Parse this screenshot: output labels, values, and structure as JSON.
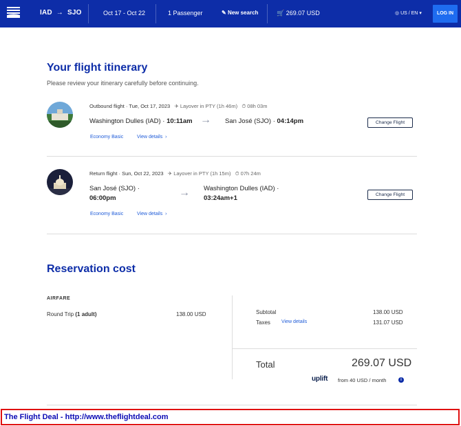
{
  "header": {
    "route_from": "IAD",
    "route_to": "SJO",
    "dates": "Oct 17 - Oct 22",
    "passengers": "1 Passenger",
    "new_search": "New search",
    "cart_price": "269.07 USD",
    "locale": "US / EN",
    "login": "LOG IN"
  },
  "itinerary": {
    "title": "Your flight itinerary",
    "subtitle": "Please review your itinerary carefully before continuing.",
    "flights": [
      {
        "label": "Outbound flight · Tue, Oct 17, 2023",
        "layover": "Layover in PTY (1h 46m)",
        "duration": "08h 03m",
        "origin": "Washington Dulles (IAD) ·",
        "origin_time": "10:11am",
        "destination": "San José (SJO) ·",
        "destination_time": "04:14pm",
        "fare": "Economy Basic",
        "details": "View details",
        "change": "Change Flight"
      },
      {
        "label": "Return flight · Sun, Oct 22, 2023",
        "layover": "Layover in PTY (1h 15m)",
        "duration": "07h 24m",
        "origin": "San José (SJO) ·",
        "origin_time": "06:00pm",
        "destination": "Washington Dulles (IAD) ·",
        "destination_time": "03:24am+1",
        "fare": "Economy Basic",
        "details": "View details",
        "change": "Change Flight"
      }
    ]
  },
  "cost": {
    "title": "Reservation cost",
    "airfare_heading": "AIRFARE",
    "round_trip_label": "Round Trip",
    "round_trip_qty": "(1 adult)",
    "round_trip_price": "138.00 USD",
    "subtotal_label": "Subtotal",
    "subtotal_value": "138.00 USD",
    "taxes_label": "Taxes",
    "taxes_link": "View details",
    "taxes_value": "131.07 USD",
    "total_label": "Total",
    "total_value": "269.07 USD",
    "uplift_brand": "uplift",
    "uplift_text": "from 40 USD  / month"
  },
  "footer": {
    "text": "The Flight Deal - http://www.theflightdeal.com"
  },
  "colors": {
    "brand_blue": "#0d2da8",
    "link_blue": "#1e5bd8",
    "footer_border": "#e01010"
  }
}
